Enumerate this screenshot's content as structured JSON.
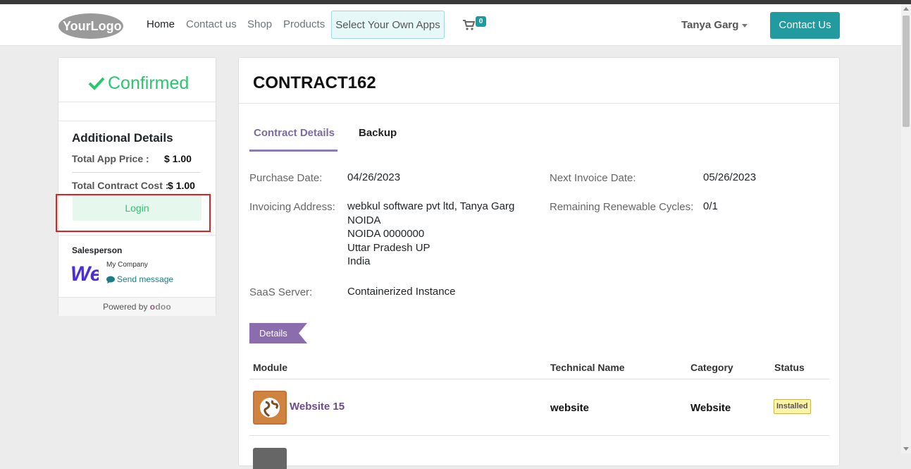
{
  "navbar": {
    "logo_text": "YourLogo",
    "links": [
      "Home",
      "Contact us",
      "Shop",
      "Products"
    ],
    "select_apps_label": "Select Your Own Apps",
    "cart_count": "0",
    "user_name": "Tanya Garg",
    "contact_button": "Contact Us"
  },
  "sidebar": {
    "status": "Confirmed",
    "additional_heading": "Additional Details",
    "total_app_price_label": "Total App Price :",
    "total_app_price_value": "$ 1.00",
    "total_contract_cost_label": "Total Contract Cost :",
    "total_contract_cost_value": "$ 1.00",
    "login_label": "Login",
    "salesperson_label": "Salesperson",
    "company_name": "My Company",
    "send_message_label": "Send message",
    "powered_by": "Powered by",
    "powered_brand_o": "o",
    "powered_brand_rest": "doo"
  },
  "contract": {
    "title": "CONTRACT162",
    "tabs": [
      "Contract Details",
      "Backup"
    ],
    "purchase_date_label": "Purchase Date:",
    "purchase_date_value": "04/26/2023",
    "next_invoice_label": "Next Invoice Date:",
    "next_invoice_value": "05/26/2023",
    "invoicing_address_label": "Invoicing Address:",
    "invoicing_address_lines": [
      "webkul software pvt ltd, Tanya Garg",
      "NOIDA",
      "NOIDA 0000000",
      "Uttar Pradesh UP",
      "India"
    ],
    "remaining_cycles_label": "Remaining Renewable Cycles:",
    "remaining_cycles_value": "0/1",
    "saas_server_label": "SaaS Server:",
    "saas_server_value": "Containerized Instance",
    "details_tag": "Details"
  },
  "modules_table": {
    "headers": [
      "Module",
      "Technical Name",
      "Category",
      "Status"
    ],
    "rows": [
      {
        "module": "Website 15",
        "technical_name": "website",
        "category": "Website",
        "status": "Installed",
        "icon": "globe-icon"
      }
    ]
  },
  "colors": {
    "accent_teal": "#219aa0",
    "confirmed_green": "#28c76f",
    "tab_purple": "#7c6aa3",
    "module_link": "#6b4a8e"
  }
}
